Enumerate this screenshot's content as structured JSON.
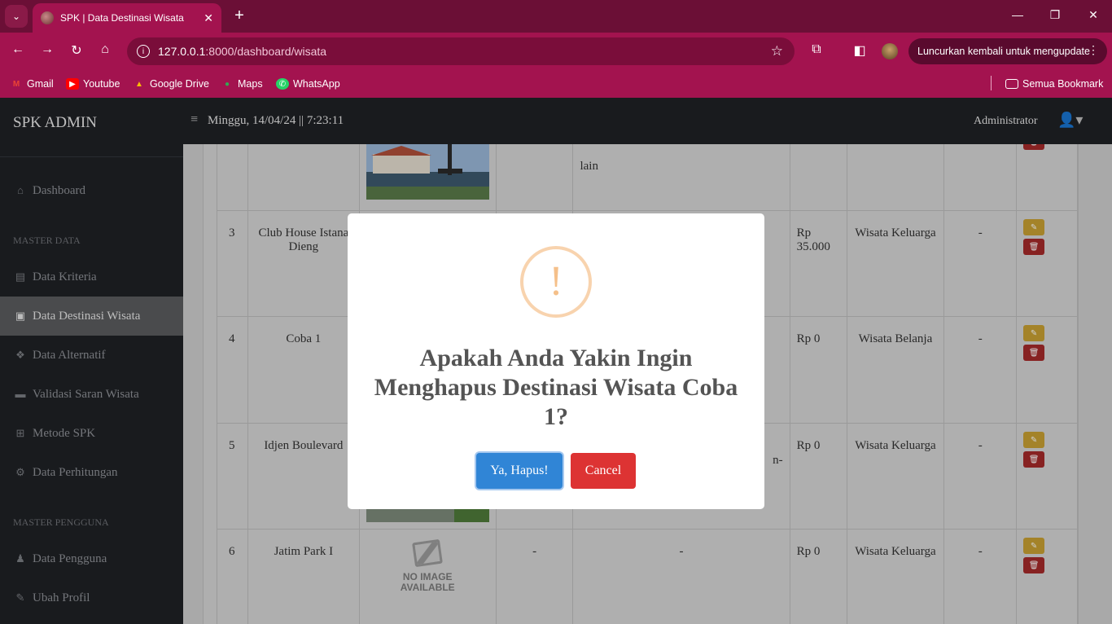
{
  "browser": {
    "tab_title": "SPK | Data Destinasi Wisata",
    "url_host": "127.0.0.1",
    "url_path": ":8000/dashboard/wisata",
    "relaunch_label": "Luncurkan kembali untuk mengupdate",
    "bookmarks": [
      {
        "label": "Gmail",
        "icon": "gmail-icon"
      },
      {
        "label": "Youtube",
        "icon": "youtube-icon"
      },
      {
        "label": "Google Drive",
        "icon": "drive-icon"
      },
      {
        "label": "Maps",
        "icon": "maps-icon"
      },
      {
        "label": "WhatsApp",
        "icon": "whatsapp-icon"
      }
    ],
    "all_bookmarks_label": "Semua Bookmark"
  },
  "app": {
    "brand": "SPK ADMIN",
    "datetime": "Minggu, 14/04/24 || 7:23:11",
    "user": "Administrator",
    "menu": {
      "dashboard": "Dashboard",
      "section_master_data": "MASTER DATA",
      "data_kriteria": "Data Kriteria",
      "data_destinasi": "Data Destinasi Wisata",
      "data_alternatif": "Data Alternatif",
      "validasi_saran": "Validasi Saran Wisata",
      "metode_spk": "Metode SPK",
      "data_perhitungan": "Data Perhitungan",
      "section_master_pengguna": "MASTER PENGGUNA",
      "data_pengguna": "Data Pengguna",
      "ubah_profil": "Ubah Profil"
    }
  },
  "table": {
    "partial_row_text": "lain",
    "rows": [
      {
        "no": "3",
        "name": "Club House Istana Dieng",
        "c4": "",
        "c5": "",
        "price": "Rp 35.000",
        "category": "Wisata Keluarga",
        "c8": "-"
      },
      {
        "no": "4",
        "name": "Coba 1",
        "c4": "",
        "c5": "",
        "price": "Rp 0",
        "category": "Wisata Belanja",
        "c8": "-"
      },
      {
        "no": "5",
        "name": "Idjen Boulevard",
        "c4": "",
        "c5": "n-",
        "price": "Rp 0",
        "category": "Wisata Keluarga",
        "c8": "-"
      },
      {
        "no": "6",
        "name": "Jatim Park I",
        "c4": "-",
        "c5": "-",
        "price": "Rp 0",
        "category": "Wisata Keluarga",
        "c8": "-"
      }
    ],
    "no_image_text": "NO IMAGE AVAILABLE"
  },
  "modal": {
    "icon": "!",
    "title": "Apakah Anda Yakin Ingin Menghapus Destinasi Wisata Coba 1?",
    "confirm_label": "Ya, Hapus!",
    "cancel_label": "Cancel"
  }
}
